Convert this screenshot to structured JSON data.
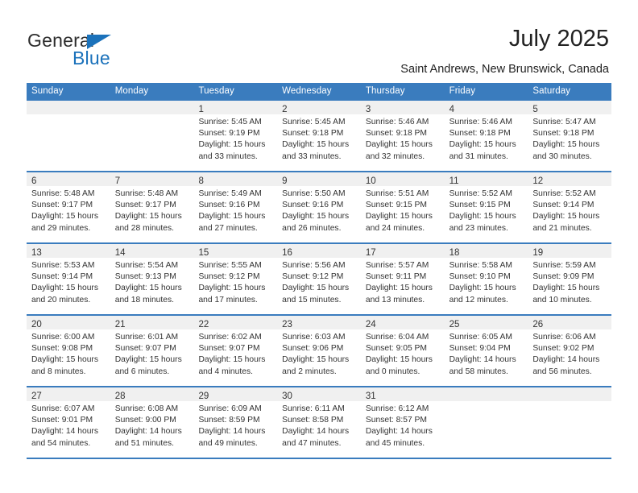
{
  "logo": {
    "word_top": "General",
    "word_bottom": "Blue",
    "triangle": "logo-triangle",
    "color_text": "#2d2d2d",
    "color_blue": "#1b72bb"
  },
  "header": {
    "title": "July 2025",
    "subtitle": "Saint Andrews, New Brunswick, Canada"
  },
  "theme": {
    "header_blue": "#3a7cbe",
    "band_gray": "#f0f0f0",
    "text": "#333333"
  },
  "weekdays": [
    "Sunday",
    "Monday",
    "Tuesday",
    "Wednesday",
    "Thursday",
    "Friday",
    "Saturday"
  ],
  "weeks": [
    [
      {
        "day": "",
        "lines": []
      },
      {
        "day": "",
        "lines": []
      },
      {
        "day": "1",
        "lines": [
          "Sunrise: 5:45 AM",
          "Sunset: 9:19 PM",
          "Daylight: 15 hours",
          "and 33 minutes."
        ]
      },
      {
        "day": "2",
        "lines": [
          "Sunrise: 5:45 AM",
          "Sunset: 9:18 PM",
          "Daylight: 15 hours",
          "and 33 minutes."
        ]
      },
      {
        "day": "3",
        "lines": [
          "Sunrise: 5:46 AM",
          "Sunset: 9:18 PM",
          "Daylight: 15 hours",
          "and 32 minutes."
        ]
      },
      {
        "day": "4",
        "lines": [
          "Sunrise: 5:46 AM",
          "Sunset: 9:18 PM",
          "Daylight: 15 hours",
          "and 31 minutes."
        ]
      },
      {
        "day": "5",
        "lines": [
          "Sunrise: 5:47 AM",
          "Sunset: 9:18 PM",
          "Daylight: 15 hours",
          "and 30 minutes."
        ]
      }
    ],
    [
      {
        "day": "6",
        "lines": [
          "Sunrise: 5:48 AM",
          "Sunset: 9:17 PM",
          "Daylight: 15 hours",
          "and 29 minutes."
        ]
      },
      {
        "day": "7",
        "lines": [
          "Sunrise: 5:48 AM",
          "Sunset: 9:17 PM",
          "Daylight: 15 hours",
          "and 28 minutes."
        ]
      },
      {
        "day": "8",
        "lines": [
          "Sunrise: 5:49 AM",
          "Sunset: 9:16 PM",
          "Daylight: 15 hours",
          "and 27 minutes."
        ]
      },
      {
        "day": "9",
        "lines": [
          "Sunrise: 5:50 AM",
          "Sunset: 9:16 PM",
          "Daylight: 15 hours",
          "and 26 minutes."
        ]
      },
      {
        "day": "10",
        "lines": [
          "Sunrise: 5:51 AM",
          "Sunset: 9:15 PM",
          "Daylight: 15 hours",
          "and 24 minutes."
        ]
      },
      {
        "day": "11",
        "lines": [
          "Sunrise: 5:52 AM",
          "Sunset: 9:15 PM",
          "Daylight: 15 hours",
          "and 23 minutes."
        ]
      },
      {
        "day": "12",
        "lines": [
          "Sunrise: 5:52 AM",
          "Sunset: 9:14 PM",
          "Daylight: 15 hours",
          "and 21 minutes."
        ]
      }
    ],
    [
      {
        "day": "13",
        "lines": [
          "Sunrise: 5:53 AM",
          "Sunset: 9:14 PM",
          "Daylight: 15 hours",
          "and 20 minutes."
        ]
      },
      {
        "day": "14",
        "lines": [
          "Sunrise: 5:54 AM",
          "Sunset: 9:13 PM",
          "Daylight: 15 hours",
          "and 18 minutes."
        ]
      },
      {
        "day": "15",
        "lines": [
          "Sunrise: 5:55 AM",
          "Sunset: 9:12 PM",
          "Daylight: 15 hours",
          "and 17 minutes."
        ]
      },
      {
        "day": "16",
        "lines": [
          "Sunrise: 5:56 AM",
          "Sunset: 9:12 PM",
          "Daylight: 15 hours",
          "and 15 minutes."
        ]
      },
      {
        "day": "17",
        "lines": [
          "Sunrise: 5:57 AM",
          "Sunset: 9:11 PM",
          "Daylight: 15 hours",
          "and 13 minutes."
        ]
      },
      {
        "day": "18",
        "lines": [
          "Sunrise: 5:58 AM",
          "Sunset: 9:10 PM",
          "Daylight: 15 hours",
          "and 12 minutes."
        ]
      },
      {
        "day": "19",
        "lines": [
          "Sunrise: 5:59 AM",
          "Sunset: 9:09 PM",
          "Daylight: 15 hours",
          "and 10 minutes."
        ]
      }
    ],
    [
      {
        "day": "20",
        "lines": [
          "Sunrise: 6:00 AM",
          "Sunset: 9:08 PM",
          "Daylight: 15 hours",
          "and 8 minutes."
        ]
      },
      {
        "day": "21",
        "lines": [
          "Sunrise: 6:01 AM",
          "Sunset: 9:07 PM",
          "Daylight: 15 hours",
          "and 6 minutes."
        ]
      },
      {
        "day": "22",
        "lines": [
          "Sunrise: 6:02 AM",
          "Sunset: 9:07 PM",
          "Daylight: 15 hours",
          "and 4 minutes."
        ]
      },
      {
        "day": "23",
        "lines": [
          "Sunrise: 6:03 AM",
          "Sunset: 9:06 PM",
          "Daylight: 15 hours",
          "and 2 minutes."
        ]
      },
      {
        "day": "24",
        "lines": [
          "Sunrise: 6:04 AM",
          "Sunset: 9:05 PM",
          "Daylight: 15 hours",
          "and 0 minutes."
        ]
      },
      {
        "day": "25",
        "lines": [
          "Sunrise: 6:05 AM",
          "Sunset: 9:04 PM",
          "Daylight: 14 hours",
          "and 58 minutes."
        ]
      },
      {
        "day": "26",
        "lines": [
          "Sunrise: 6:06 AM",
          "Sunset: 9:02 PM",
          "Daylight: 14 hours",
          "and 56 minutes."
        ]
      }
    ],
    [
      {
        "day": "27",
        "lines": [
          "Sunrise: 6:07 AM",
          "Sunset: 9:01 PM",
          "Daylight: 14 hours",
          "and 54 minutes."
        ]
      },
      {
        "day": "28",
        "lines": [
          "Sunrise: 6:08 AM",
          "Sunset: 9:00 PM",
          "Daylight: 14 hours",
          "and 51 minutes."
        ]
      },
      {
        "day": "29",
        "lines": [
          "Sunrise: 6:09 AM",
          "Sunset: 8:59 PM",
          "Daylight: 14 hours",
          "and 49 minutes."
        ]
      },
      {
        "day": "30",
        "lines": [
          "Sunrise: 6:11 AM",
          "Sunset: 8:58 PM",
          "Daylight: 14 hours",
          "and 47 minutes."
        ]
      },
      {
        "day": "31",
        "lines": [
          "Sunrise: 6:12 AM",
          "Sunset: 8:57 PM",
          "Daylight: 14 hours",
          "and 45 minutes."
        ]
      },
      {
        "day": "",
        "lines": []
      },
      {
        "day": "",
        "lines": []
      }
    ]
  ]
}
